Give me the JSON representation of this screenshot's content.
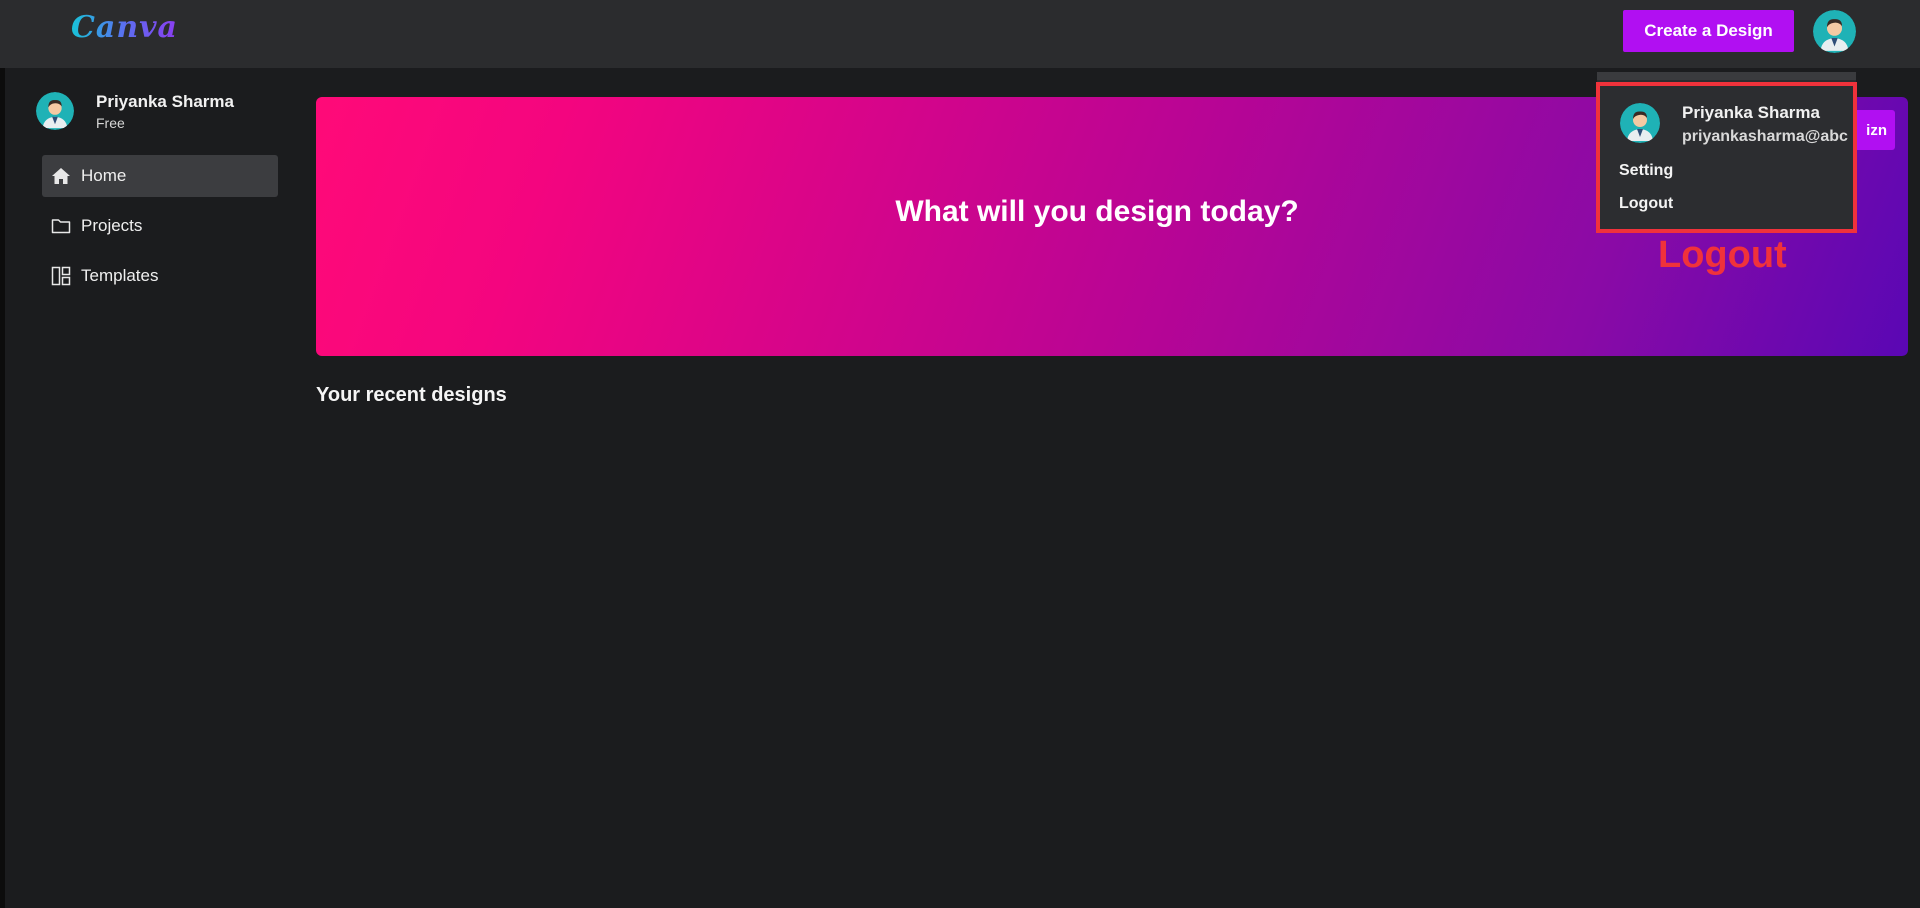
{
  "app": {
    "logo_text": "Canva",
    "create_button_label": "Create a Design",
    "accent_color": "#b10ff2"
  },
  "sidebar": {
    "user_name": "Priyanka Sharma",
    "user_plan": "Free",
    "items": [
      {
        "label": "Home",
        "icon": "home-icon",
        "active": true
      },
      {
        "label": "Projects",
        "icon": "folder-icon",
        "active": false
      },
      {
        "label": "Templates",
        "icon": "templates-icon",
        "active": false
      }
    ]
  },
  "main": {
    "hero_title": "What will you design today?",
    "hero_button_label": "izn",
    "recent_title": "Your recent designs",
    "hero_gradient": [
      "#ff0a78",
      "#5a07b4"
    ]
  },
  "user_menu": {
    "name": "Priyanka Sharma",
    "email": "priyankasharma@abc.com",
    "items": [
      "Setting",
      "Logout"
    ]
  },
  "annotation": {
    "label": "Logout",
    "color": "#f0323b"
  }
}
